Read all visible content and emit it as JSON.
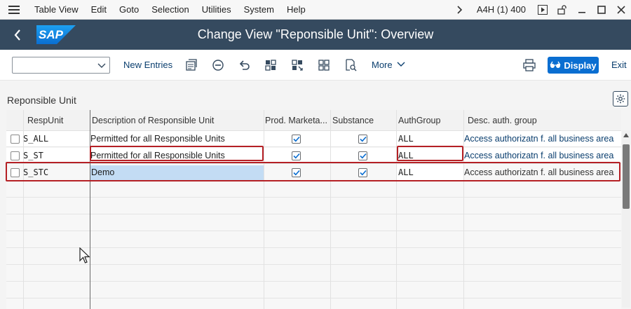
{
  "menubar": {
    "items": [
      "Table View",
      "Edit",
      "Goto",
      "Selection",
      "Utilities",
      "System",
      "Help"
    ],
    "system_info": "A4H (1) 400"
  },
  "titlebar": {
    "title": "Change View \"Reponsible Unit\": Overview",
    "logo_text": "SAP"
  },
  "toolbar": {
    "select_value": "",
    "new_entries": "New Entries",
    "more": "More",
    "display": "Display",
    "exit": "Exit"
  },
  "section": {
    "title": "Reponsible Unit"
  },
  "table": {
    "columns": [
      "RespUnit",
      "Description of Responsible Unit",
      "Prod. Marketa...",
      "Substance",
      "AuthGroup",
      "Desc. auth. group"
    ],
    "rows": [
      {
        "resp_unit": "S_ALL",
        "description": "Permitted for all Responsible Units",
        "prod_marketability": true,
        "substance": true,
        "auth_group": "ALL",
        "auth_desc": "Access authorizatn f. all business areas"
      },
      {
        "resp_unit": "S_ST",
        "description": "Permitted for all Responsible Units",
        "prod_marketability": true,
        "substance": true,
        "auth_group": "ALL",
        "auth_desc": "Access authorizatn f. all business areas"
      },
      {
        "resp_unit": "S_STC",
        "description": "Demo",
        "prod_marketability": true,
        "substance": true,
        "auth_group": "ALL",
        "auth_desc": "Access authorizatn f. all business areas"
      }
    ]
  },
  "colors": {
    "shell_header": "#354a5f",
    "emphasized_button": "#0a6ed1",
    "highlight_border": "#b52025",
    "focus_cell": "#c3dcf4"
  }
}
